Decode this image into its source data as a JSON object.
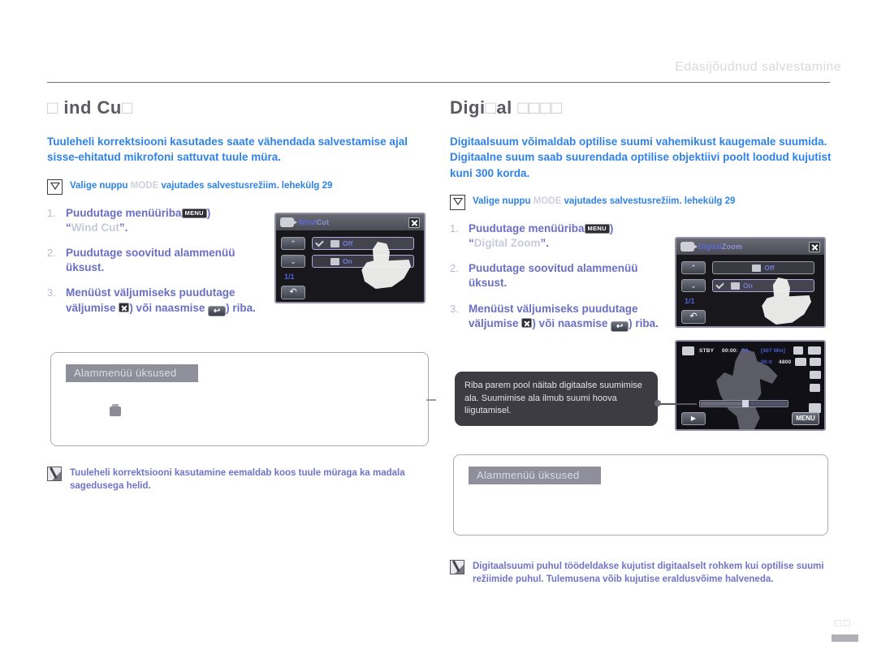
{
  "header": {
    "running_head": "Edasijõudnud salvestamine"
  },
  "left": {
    "title_prefix": "□",
    "title": "ind Cu",
    "title_suffix": "□",
    "intro": "Tuuleheli korrektsiooni kasutades saate vähendada salvestamise ajal sisse-ehitatud mikrofoni sattuvat tuule müra.",
    "mode": {
      "before": "Valige nuppu",
      "ghost": "MODE",
      "after": "vajutades salvestusrežiim.",
      "page_ref": "lehekülg 29"
    },
    "steps": [
      {
        "num": "1.",
        "text": "Puudutage menüüriba",
        "chip": "MENU",
        "tail": ")",
        "quoted": "Wind Cut"
      },
      {
        "num": "2.",
        "text": "Puudutage soovitud alammenüü üksust."
      },
      {
        "num": "3.",
        "text": "Menüüst väljumiseks puudutage väljumise",
        "mid": ") või naasmise",
        "tail": ") riba."
      }
    ],
    "lcd": {
      "title_a": "Wind",
      "title_b": "Cut",
      "up": "⌃",
      "down": "⌄",
      "items": [
        {
          "label": "Off",
          "checked": true
        },
        {
          "label": "On",
          "checked": false
        }
      ],
      "pager": "1/1",
      "return": "↶"
    },
    "submenu_box": {
      "heading": "Alammenüü üksused"
    },
    "note": "Tuuleheli korrektsiooni kasutamine eemaldab koos tuule müraga ka madala sagedusega helid."
  },
  "right": {
    "title": "Digi",
    "title_mid": "□",
    "title_rest": "al",
    "title_miss": "□□□□",
    "intro": "Digitaalsuum võimaldab optilise suumi vahemikust kaugemale suumida. Digitaalne suum saab suurendada optilise objektiivi poolt loodud kujutist kuni 300 korda.",
    "mode": {
      "before": "Valige nuppu",
      "ghost": "MODE",
      "after": "vajutades salvestusrežiim.",
      "page_ref": "lehekülg 29"
    },
    "steps": [
      {
        "num": "1.",
        "text": "Puudutage menüüriba",
        "chip": "MENU",
        "tail": ")",
        "quoted": "Digital Zoom"
      },
      {
        "num": "2.",
        "text": "Puudutage soovitud alammenüü üksust."
      },
      {
        "num": "3.",
        "text": "Menüüst väljumiseks puudutage väljumise",
        "mid": ") või naasmise",
        "tail": ") riba."
      }
    ],
    "lcd_menu": {
      "title_a": "Digital",
      "title_b": "Zoom",
      "up": "⌃",
      "down": "⌄",
      "items": [
        {
          "label": "Off",
          "checked": false
        },
        {
          "label": "On",
          "checked": true
        }
      ],
      "pager": "1/1",
      "return": "↶"
    },
    "lcd_preview": {
      "status": "STBY",
      "timecode": "00:00:",
      "timecode_blue": "00",
      "remaining": "[307 Min]",
      "counter": "00:0",
      "resolution": "4800",
      "play_label": "▶",
      "menu_label": "MENU"
    },
    "bubble": "Riba parem pool näitab digitaalse suumimise ala. Suumimise ala ilmub suumi hoova liigutamisel.",
    "submenu_box": {
      "heading": "Alammenüü üksused"
    },
    "note": "Digitaalsuumi puhul töödeldakse kujutist digitaalselt rohkem kui optilise suumi režiimide puhul. Tulemusena võib kujutise eraldusvõime halveneda."
  },
  "folio": {
    "page_number": "□□"
  }
}
